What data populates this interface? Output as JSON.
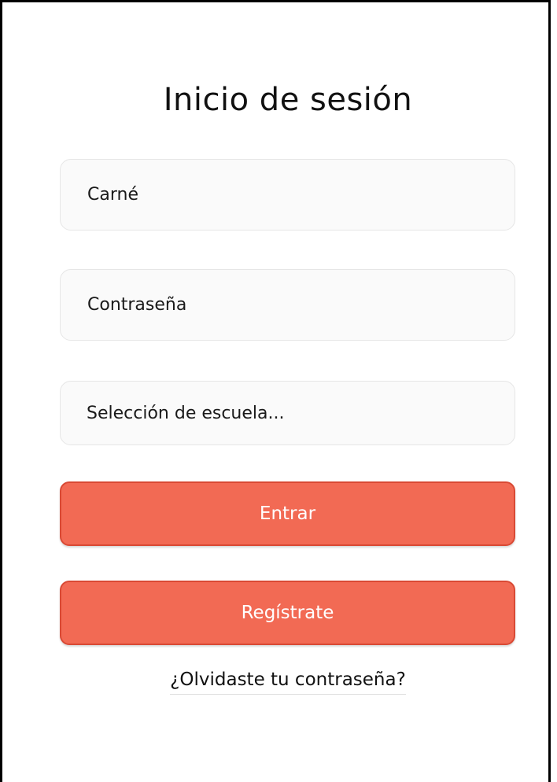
{
  "page": {
    "title": "Inicio de sesión"
  },
  "form": {
    "carne_placeholder": "Carné",
    "password_placeholder": "Contraseña",
    "school_select_placeholder": "Selección de escuela..."
  },
  "buttons": {
    "login_label": "Entrar",
    "register_label": "Regístrate"
  },
  "links": {
    "forgot_password": "¿Olvidaste tu contraseña?"
  },
  "colors": {
    "button_primary": "#f26a54",
    "button_border": "#d94a35",
    "field_bg": "#fafafa"
  }
}
